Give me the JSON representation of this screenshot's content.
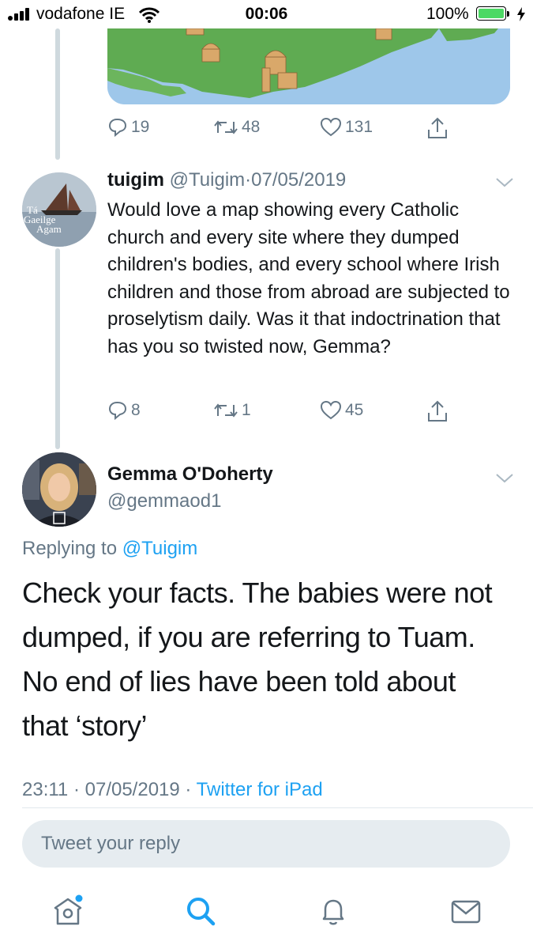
{
  "status_bar": {
    "carrier": "vodafone IE",
    "time": "00:06",
    "battery": "100%"
  },
  "previous_tweet": {
    "actions": {
      "replies": "19",
      "retweets": "48",
      "likes": "131"
    }
  },
  "reply_tweet": {
    "display_name": "tuigim",
    "handle": "@Tuigim",
    "separator": "·",
    "date": "07/05/2019",
    "avatar_text": [
      "Tá",
      "Gaeilge",
      "Agam"
    ],
    "text": "Would love a map showing every Catholic church and every site where they dumped children's bodies, and every school where Irish children and those from abroad are subjected to proselytism daily. Was it that indoctrination that has you so twisted now, Gemma?",
    "actions": {
      "replies": "8",
      "retweets": "1",
      "likes": "45"
    }
  },
  "main_tweet": {
    "display_name": "Gemma O'Doherty",
    "handle": "@gemmaod1",
    "replying_prefix": "Replying to",
    "replying_to": "@Tuigim",
    "text_lines": [
      "Check your facts. The babies were not",
      "dumped, if you are referring to Tuam.",
      "No end of lies have been told about",
      "that ‘story’"
    ],
    "time": "23:11",
    "separator": "·",
    "date": "07/05/2019",
    "separator2": "·",
    "source": "Twitter for iPad"
  },
  "reply_box": {
    "placeholder": "Tweet your reply"
  },
  "tab_bar": {
    "items": [
      {
        "icon": "home-icon",
        "active": false,
        "has_dot": true
      },
      {
        "icon": "search-icon",
        "active": true
      },
      {
        "icon": "notifications-icon",
        "active": false
      },
      {
        "icon": "messages-icon",
        "active": false
      }
    ]
  },
  "colors": {
    "accent": "#1da1f2",
    "muted": "#657786",
    "thread_line": "#cfd9de",
    "battery": "#4cd964"
  }
}
